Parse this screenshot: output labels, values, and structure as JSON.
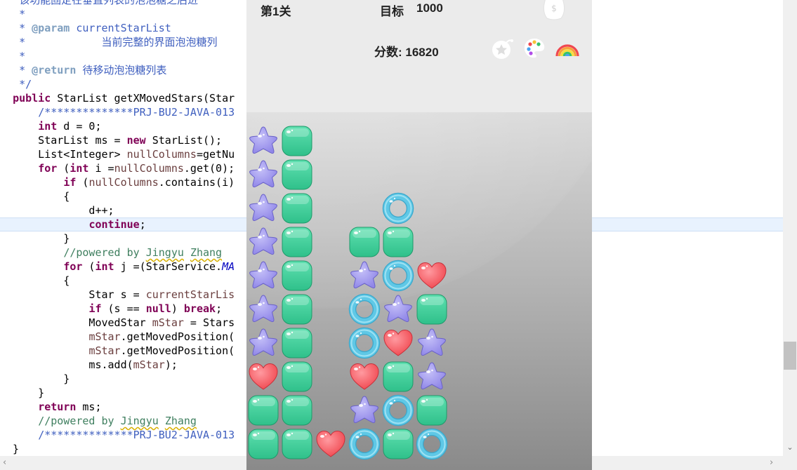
{
  "editor": {
    "lines": [
      {
        "parts": [
          [
            "cmt",
            "   该功能固定在垂直列表的泡泡糖之后进"
          ]
        ]
      },
      {
        "parts": [
          [
            "cmt",
            "   *"
          ]
        ]
      },
      {
        "parts": [
          [
            "cmt",
            "   * "
          ],
          [
            "tag",
            "@param"
          ],
          [
            "cmt",
            " currentStarList"
          ]
        ]
      },
      {
        "parts": [
          [
            "cmt",
            "   *            当前完整的界面泡泡糖列"
          ]
        ]
      },
      {
        "parts": [
          [
            "cmt",
            "   *"
          ]
        ]
      },
      {
        "parts": [
          [
            "cmt",
            "   * "
          ],
          [
            "tag",
            "@return"
          ],
          [
            "cmt",
            " 待移动泡泡糖列表"
          ]
        ]
      },
      {
        "parts": [
          [
            "cmt",
            "   */"
          ]
        ]
      },
      {
        "parts": [
          [
            "plain",
            "  "
          ],
          [
            "kw",
            "public"
          ],
          [
            "plain",
            " StarList getXMovedStars(Star"
          ]
        ]
      },
      {
        "parts": [
          [
            "plain",
            "      "
          ],
          [
            "cmt",
            "/**************PRJ-BU2-JAVA-013"
          ]
        ]
      },
      {
        "parts": [
          [
            "plain",
            "      "
          ],
          [
            "kw",
            "int"
          ],
          [
            "plain",
            " d = 0;"
          ]
        ]
      },
      {
        "parts": [
          [
            "plain",
            "      StarList ms = "
          ],
          [
            "kw",
            "new"
          ],
          [
            "plain",
            " StarList();"
          ]
        ]
      },
      {
        "parts": [
          [
            "plain",
            "      List<Integer> "
          ],
          [
            "var",
            "nullColumns"
          ],
          [
            "plain",
            "=getNu"
          ]
        ]
      },
      {
        "parts": [
          [
            "plain",
            "      "
          ],
          [
            "kw",
            "for"
          ],
          [
            "plain",
            " ("
          ],
          [
            "kw",
            "int"
          ],
          [
            "plain",
            " i ="
          ],
          [
            "var",
            "nullColumns"
          ],
          [
            "plain",
            ".get(0);"
          ]
        ]
      },
      {
        "parts": [
          [
            "plain",
            "          "
          ],
          [
            "kw",
            "if"
          ],
          [
            "plain",
            " ("
          ],
          [
            "var",
            "nullColumns"
          ],
          [
            "plain",
            ".contains(i)"
          ]
        ]
      },
      {
        "parts": [
          [
            "plain",
            "          {"
          ]
        ]
      },
      {
        "parts": [
          [
            "plain",
            "              d++;"
          ]
        ]
      },
      {
        "parts": [
          [
            "plain",
            "              "
          ],
          [
            "kw",
            "continue"
          ],
          [
            "plain",
            ";"
          ]
        ],
        "current": true
      },
      {
        "parts": [
          [
            "plain",
            "          }"
          ]
        ]
      },
      {
        "parts": [
          [
            "plain",
            "          "
          ],
          [
            "lcmt",
            "//powered by "
          ],
          [
            "lcmtsq",
            "Jingyu"
          ],
          [
            "lcmt",
            " "
          ],
          [
            "lcmtsq",
            "Zhang"
          ]
        ]
      },
      {
        "parts": [
          [
            "plain",
            "          "
          ],
          [
            "kw",
            "for"
          ],
          [
            "plain",
            " ("
          ],
          [
            "kw",
            "int"
          ],
          [
            "plain",
            " j =(StarService."
          ],
          [
            "field",
            "MA"
          ]
        ]
      },
      {
        "parts": [
          [
            "plain",
            "          {"
          ]
        ]
      },
      {
        "parts": [
          [
            "plain",
            "              Star s = "
          ],
          [
            "var",
            "currentStarLis"
          ]
        ]
      },
      {
        "parts": [
          [
            "plain",
            "              "
          ],
          [
            "kw",
            "if"
          ],
          [
            "plain",
            " (s == "
          ],
          [
            "kw",
            "null"
          ],
          [
            "plain",
            ") "
          ],
          [
            "kw",
            "break"
          ],
          [
            "plain",
            ";"
          ]
        ]
      },
      {
        "parts": [
          [
            "plain",
            "              MovedStar "
          ],
          [
            "var",
            "mStar"
          ],
          [
            "plain",
            " = Stars"
          ]
        ]
      },
      {
        "parts": [
          [
            "plain",
            "              "
          ],
          [
            "var",
            "mStar"
          ],
          [
            "plain",
            ".getMovedPosition("
          ]
        ]
      },
      {
        "parts": [
          [
            "plain",
            "              "
          ],
          [
            "var",
            "mStar"
          ],
          [
            "plain",
            ".getMovedPosition("
          ]
        ]
      },
      {
        "parts": [
          [
            "plain",
            "              ms.add("
          ],
          [
            "var",
            "mStar"
          ],
          [
            "plain",
            ");"
          ]
        ]
      },
      {
        "parts": [
          [
            "plain",
            "          }"
          ]
        ]
      },
      {
        "parts": [
          [
            "plain",
            "      }"
          ]
        ]
      },
      {
        "parts": [
          [
            "plain",
            "      "
          ],
          [
            "kw",
            "return"
          ],
          [
            "plain",
            " ms;"
          ]
        ]
      },
      {
        "parts": [
          [
            "plain",
            "      "
          ],
          [
            "lcmt",
            "//powered by "
          ],
          [
            "lcmtsq",
            "Jingyu"
          ],
          [
            "lcmt",
            " "
          ],
          [
            "lcmtsq",
            "Zhang"
          ]
        ]
      },
      {
        "parts": [
          [
            "plain",
            "      "
          ],
          [
            "cmt",
            "/**************PRJ-BU2-JAVA-013"
          ]
        ]
      },
      {
        "parts": [
          [
            "plain",
            "  }"
          ]
        ]
      }
    ]
  },
  "scrollbars": {
    "down_arrow": "⌄",
    "left_arrow": "‹",
    "right_arrow": "›"
  },
  "game": {
    "level_label": "第1关",
    "target_label": "目标",
    "target_value": "1000",
    "score_label": "分数: 16820",
    "buttons": [
      "bomb-star-icon",
      "palette-icon",
      "rainbow-icon"
    ],
    "board": {
      "columns": 10,
      "rows": 10,
      "grid": [
        [
          ".",
          ".",
          ".",
          ".",
          ".",
          ".",
          ".",
          ".",
          ".",
          "."
        ],
        [
          "S",
          "G",
          ".",
          ".",
          ".",
          ".",
          ".",
          ".",
          ".",
          "."
        ],
        [
          "S",
          "G",
          ".",
          ".",
          ".",
          ".",
          ".",
          ".",
          ".",
          "."
        ],
        [
          "S",
          "G",
          ".",
          ".",
          "R",
          ".",
          ".",
          ".",
          ".",
          "."
        ],
        [
          "S",
          "G",
          ".",
          "G",
          "G",
          ".",
          ".",
          ".",
          ".",
          "."
        ],
        [
          "S",
          "G",
          ".",
          "S",
          "R",
          "H",
          ".",
          ".",
          ".",
          "."
        ],
        [
          "S",
          "G",
          ".",
          "R",
          "S",
          "G",
          ".",
          ".",
          ".",
          "."
        ],
        [
          "S",
          "G",
          ".",
          "R",
          "H",
          "S",
          ".",
          ".",
          ".",
          "."
        ],
        [
          "H",
          "G",
          ".",
          "H",
          "G",
          "S",
          ".",
          ".",
          ".",
          "."
        ],
        [
          "G",
          "G",
          ".",
          "S",
          "R",
          "G",
          ".",
          ".",
          ".",
          "."
        ],
        [
          "G",
          "G",
          "H",
          "R",
          "G",
          "R",
          ".",
          ".",
          ".",
          "."
        ]
      ],
      "legend": {
        "S": "purple-star",
        "G": "green-square",
        "R": "blue-ring",
        "H": "red-heart"
      }
    },
    "colors": {
      "star": "#8f86e8",
      "square": "#2fc08a",
      "ring": "#5fc8e6",
      "heart": "#f0474f"
    }
  }
}
